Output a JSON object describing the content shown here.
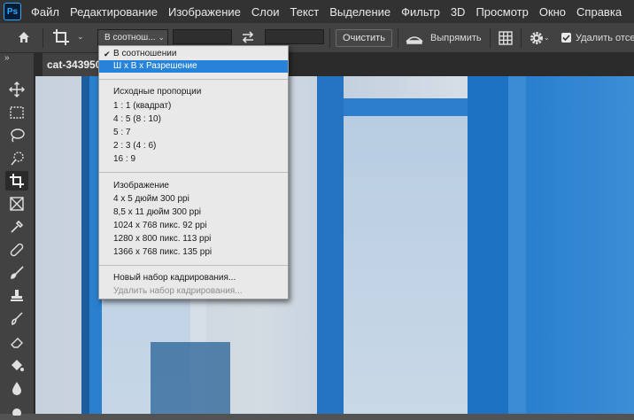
{
  "app": {
    "logo": "Ps"
  },
  "menu": [
    "Файл",
    "Редактирование",
    "Изображение",
    "Слои",
    "Текст",
    "Выделение",
    "Фильтр",
    "3D",
    "Просмотр",
    "Окно",
    "Справка"
  ],
  "options_bar": {
    "ratio_select_value": "В соотнош...",
    "clear_button": "Очистить",
    "straighten_label": "Выпрямить",
    "delete_pixels_label": "Удалить отсеч"
  },
  "document": {
    "tab_title": "cat-3439500"
  },
  "dropdown": {
    "items_top": [
      {
        "label": "В соотношении",
        "checked": true
      },
      {
        "label": "Ш x В x Разрешение",
        "highlighted": true
      }
    ],
    "section_original": {
      "heading": "Исходные пропорции",
      "items": [
        "1 : 1 (квадрат)",
        "4 : 5 (8 : 10)",
        "5 : 7",
        "2 : 3 (4 : 6)",
        "16 : 9"
      ]
    },
    "section_image": {
      "heading": "Изображение",
      "items": [
        "4 x 5 дюйм 300 ppi",
        "8,5 x 11 дюйм 300 ppi",
        "1024 x 768 пикс. 92 ppi",
        "1280 x 800 пикс. 113 ppi",
        "1366 x 768 пикс. 135 ppi"
      ]
    },
    "section_presets": {
      "new_preset": "Новый набор кадрирования...",
      "delete_preset": "Удалить набор кадрирования..."
    }
  },
  "icons": {
    "home": "home-icon",
    "crop": "crop-icon",
    "swap": "swap-icon",
    "straighten": "straighten-icon",
    "grid": "grid-icon",
    "gear": "gear-icon"
  },
  "colors": {
    "highlight": "#2783d9",
    "menubar": "#323232",
    "panel": "#424242"
  }
}
